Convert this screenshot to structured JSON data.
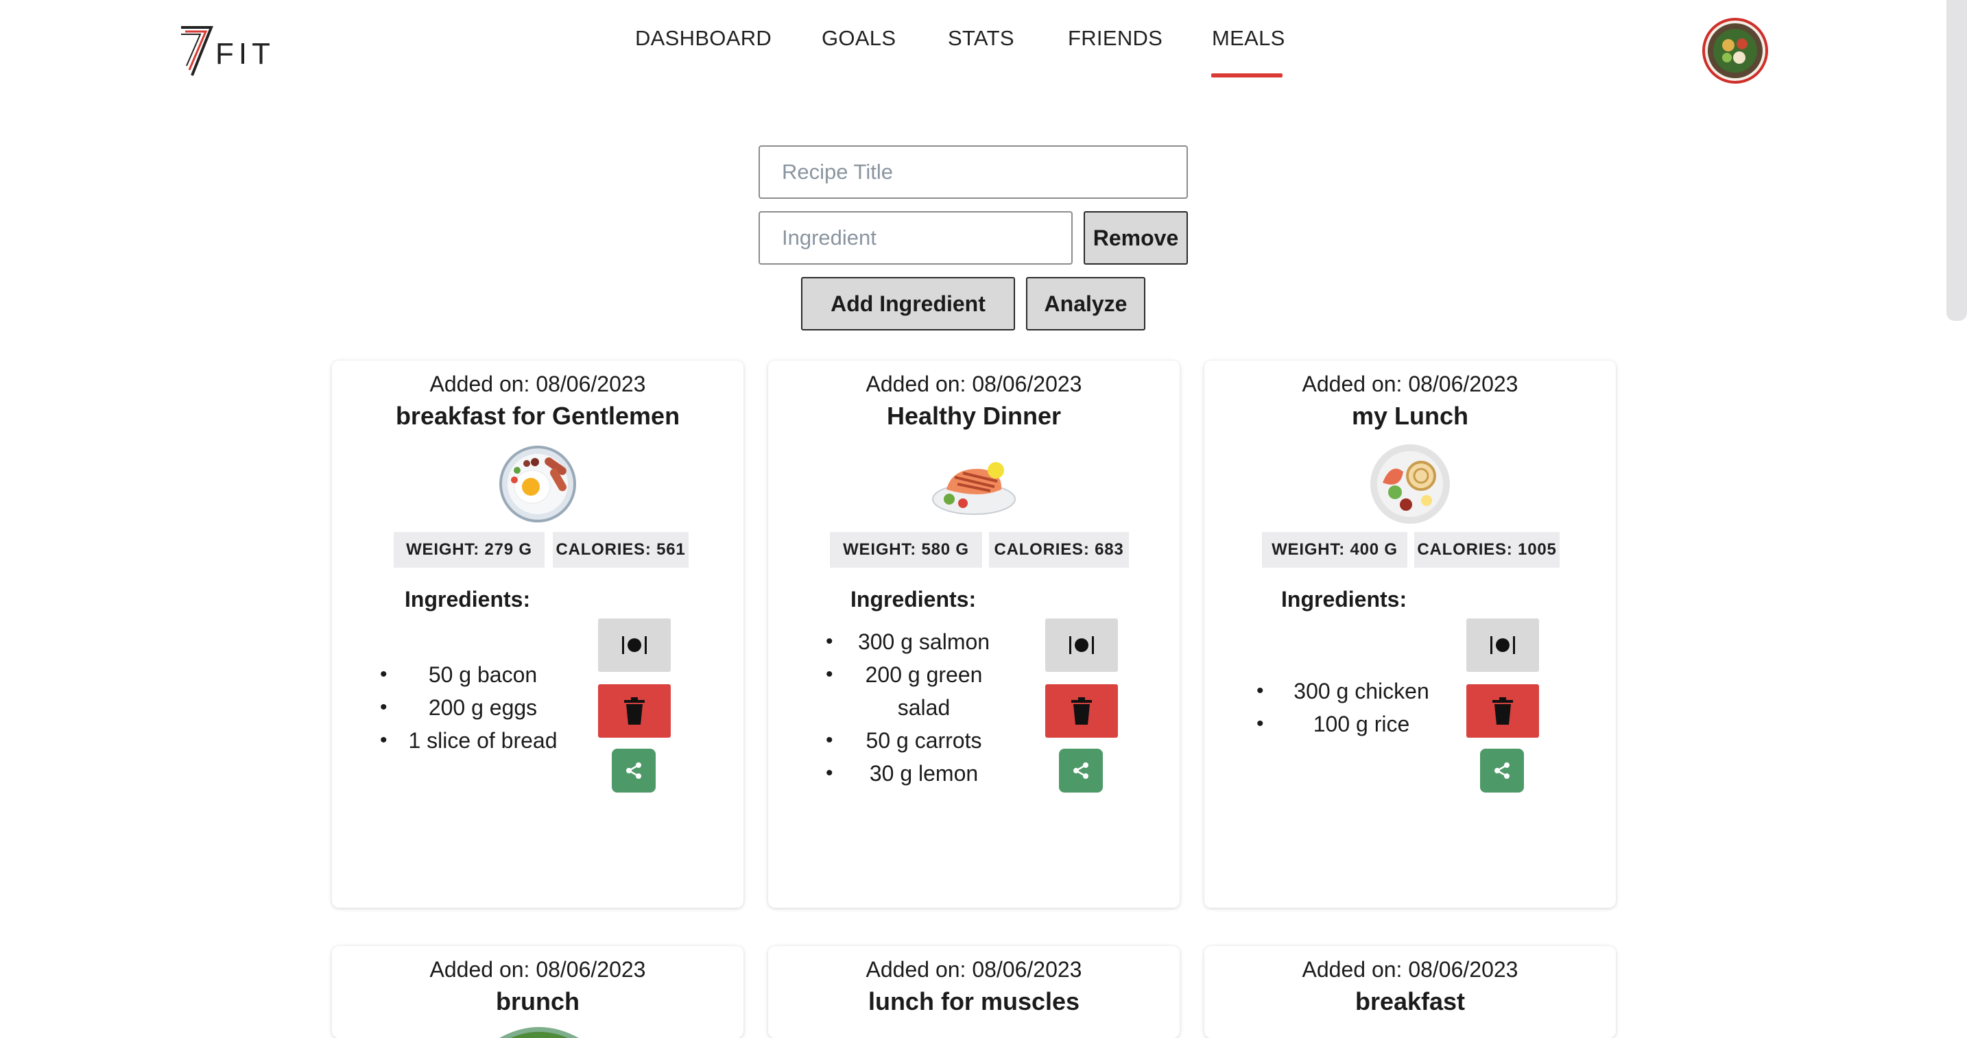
{
  "app": {
    "logo_mark": "7",
    "logo_text": "FIT"
  },
  "nav": {
    "items": [
      {
        "label": "DASHBOARD"
      },
      {
        "label": "GOALS"
      },
      {
        "label": "STATS"
      },
      {
        "label": "FRIENDS"
      },
      {
        "label": "MEALS",
        "active": true
      }
    ]
  },
  "form": {
    "recipe_title_placeholder": "Recipe Title",
    "recipe_title_value": "",
    "ingredient_placeholder": "Ingredient",
    "ingredient_value": "",
    "remove_label": "Remove",
    "add_ingredient_label": "Add Ingredient",
    "analyze_label": "Analyze"
  },
  "cards": [
    {
      "date": "Added on: 08/06/2023",
      "title": "breakfast for Gentlemen",
      "weight": "WEIGHT: 279 G",
      "calories": "CALORIES: 561",
      "ingredients_label": "Ingredients:",
      "ingredients": [
        "50 g bacon",
        "200 g eggs",
        "1 slice of bread"
      ],
      "image": "breakfast-plate-icon"
    },
    {
      "date": "Added on: 08/06/2023",
      "title": "Healthy Dinner",
      "weight": "WEIGHT: 580 G",
      "calories": "CALORIES: 683",
      "ingredients_label": "Ingredients:",
      "ingredients": [
        "300 g salmon",
        "200 g green",
        "salad",
        "50 g carrots",
        "30 g lemon"
      ],
      "image": "salmon-plate-icon"
    },
    {
      "date": "Added on: 08/06/2023",
      "title": "my Lunch",
      "weight": "WEIGHT: 400 G",
      "calories": "CALORIES: 1005",
      "ingredients_label": "Ingredients:",
      "ingredients": [
        "300 g chicken",
        "100 g rice"
      ],
      "image": "lunch-plate-icon"
    },
    {
      "date": "Added on: 08/06/2023",
      "title": "brunch"
    },
    {
      "date": "Added on: 08/06/2023",
      "title": "lunch for muscles"
    },
    {
      "date": "Added on: 08/06/2023",
      "title": "breakfast"
    }
  ],
  "colors": {
    "accent": "#d93a34",
    "delete": "#d9423e",
    "share": "#4e9968",
    "badge_bg": "#ececef",
    "button_bg": "#d9d9d9"
  },
  "icons": {
    "meal_button": "plate-utensils-icon",
    "delete_button": "trash-icon",
    "share_button": "share-icon"
  }
}
